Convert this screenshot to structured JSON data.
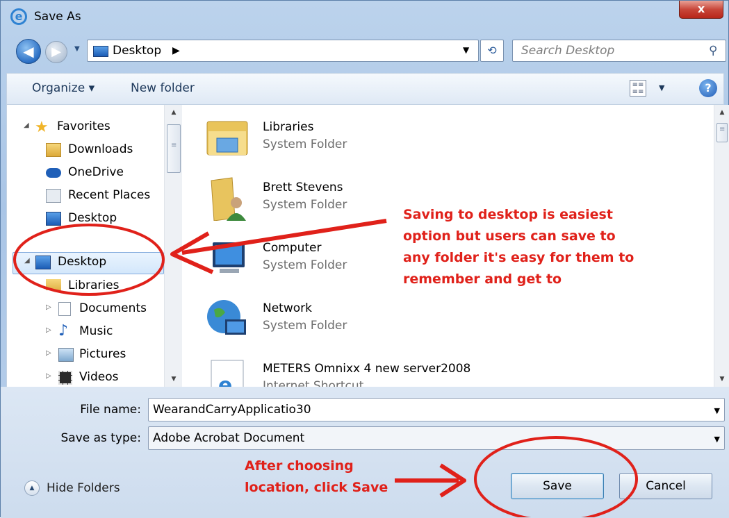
{
  "window": {
    "title": "Save As",
    "close_glyph": "x"
  },
  "navigation": {
    "back_icon": "back-arrow-icon",
    "forward_icon": "forward-arrow-icon",
    "address": "Desktop",
    "address_separator": "▶",
    "search_placeholder": "Search Desktop"
  },
  "toolbar": {
    "organize": "Organize ▾",
    "new_folder": "New folder"
  },
  "nav_pane": {
    "favorites": "Favorites",
    "items": [
      {
        "label": "Downloads",
        "icon": "downloads-folder-icon"
      },
      {
        "label": "OneDrive",
        "icon": "onedrive-cloud-icon"
      },
      {
        "label": "Recent Places",
        "icon": "recent-places-icon"
      },
      {
        "label": "Desktop",
        "icon": "desktop-icon"
      }
    ],
    "desktop": "Desktop",
    "libraries": "Libraries",
    "library_items": [
      {
        "label": "Documents",
        "icon": "documents-icon"
      },
      {
        "label": "Music",
        "icon": "music-icon"
      },
      {
        "label": "Pictures",
        "icon": "pictures-icon"
      },
      {
        "label": "Videos",
        "icon": "videos-icon"
      }
    ]
  },
  "files": [
    {
      "name": "Libraries",
      "type": "System Folder",
      "icon": "libraries-folder-icon"
    },
    {
      "name": "Brett Stevens",
      "type": "System Folder",
      "icon": "user-folder-icon"
    },
    {
      "name": "Computer",
      "type": "System Folder",
      "icon": "computer-icon"
    },
    {
      "name": "Network",
      "type": "System Folder",
      "icon": "network-globe-icon"
    },
    {
      "name": "METERS Omnixx 4 new server2008",
      "type": "Internet Shortcut",
      "icon": "internet-shortcut-icon"
    }
  ],
  "form": {
    "file_name_label": "File name:",
    "file_name_value": "WearandCarryApplicatio30",
    "save_type_label": "Save as type:",
    "save_type_value": "Adobe Acrobat Document"
  },
  "footer": {
    "hide_folders": "Hide Folders",
    "save": "Save",
    "cancel": "Cancel"
  },
  "annotations": {
    "desktop_note": "Saving to desktop is easiest\noption but users can save to\nany folder it's easy for them to\nremember and get to",
    "save_note": "After choosing\nlocation, click Save",
    "color": "#e0211a"
  }
}
